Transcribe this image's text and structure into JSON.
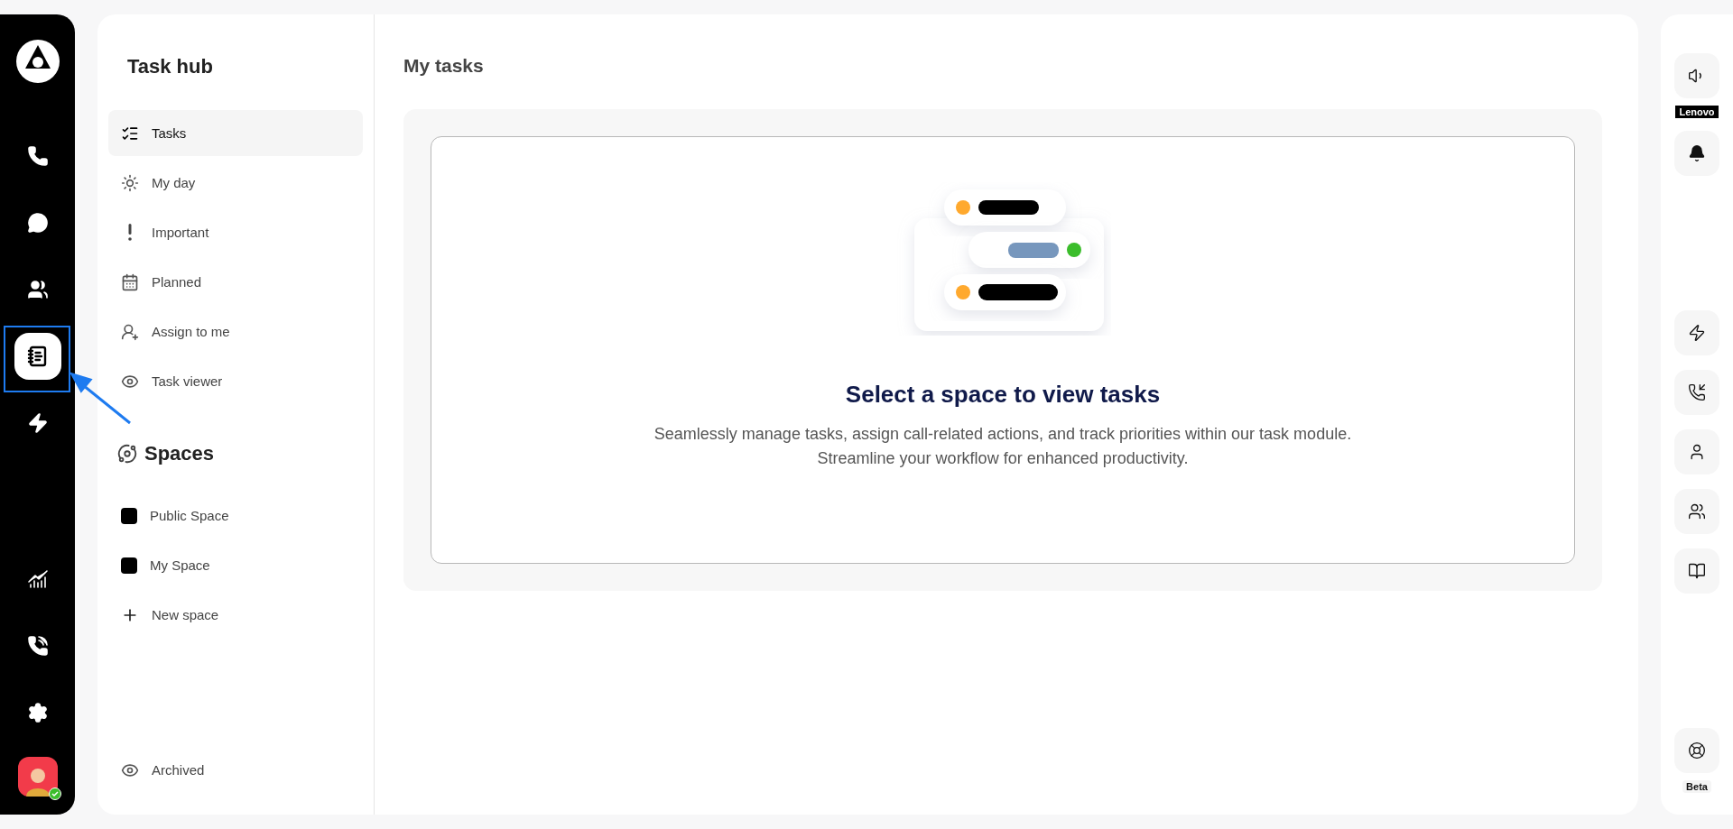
{
  "rail": {
    "top": [
      {
        "kind": "phone",
        "selected": false
      },
      {
        "kind": "chat",
        "selected": false
      },
      {
        "kind": "contacts",
        "selected": false
      },
      {
        "kind": "tasks",
        "selected": true
      },
      {
        "kind": "apps",
        "selected": false
      }
    ],
    "bottom": [
      {
        "kind": "analytics",
        "selected": false
      },
      {
        "kind": "call-activity",
        "selected": false
      },
      {
        "kind": "settings",
        "selected": false
      }
    ],
    "avatar": {
      "online": true
    }
  },
  "sidebar": {
    "title": "Task hub",
    "items": [
      {
        "label": "Tasks",
        "kind": "checklist",
        "selected": true
      },
      {
        "label": "My day",
        "kind": "sun",
        "selected": false
      },
      {
        "label": "Important",
        "kind": "exclaim",
        "selected": false
      },
      {
        "label": "Planned",
        "kind": "calendar",
        "selected": false
      },
      {
        "label": "Assign to me",
        "kind": "assign",
        "selected": false
      },
      {
        "label": "Task viewer",
        "kind": "eye",
        "selected": false
      }
    ],
    "spaces_title": "Spaces",
    "spaces": [
      {
        "label": "Public Space",
        "kind": "space"
      },
      {
        "label": "My Space",
        "kind": "space"
      },
      {
        "label": "New space",
        "kind": "add"
      }
    ],
    "archived": "Archived"
  },
  "main": {
    "title": "My tasks",
    "empty_state": {
      "heading": "Select a space to view tasks",
      "lines": [
        "Seamlessly manage tasks, assign call-related actions, and track priorities within our task module.",
        "Streamline your workflow for enhanced productivity."
      ]
    }
  },
  "right_bar": {
    "items": [
      {
        "kind": "speaker",
        "badge": {
          "text": "Lenovo",
          "kind": "dark"
        }
      },
      {
        "kind": "bell"
      },
      {
        "kind": "gap"
      },
      {
        "kind": "apps"
      },
      {
        "kind": "favorite-call"
      },
      {
        "kind": "user"
      },
      {
        "kind": "users"
      },
      {
        "kind": "book"
      },
      {
        "kind": "gap"
      },
      {
        "kind": "lifebuoy",
        "badge": {
          "text": "Beta",
          "kind": "light"
        }
      }
    ]
  }
}
